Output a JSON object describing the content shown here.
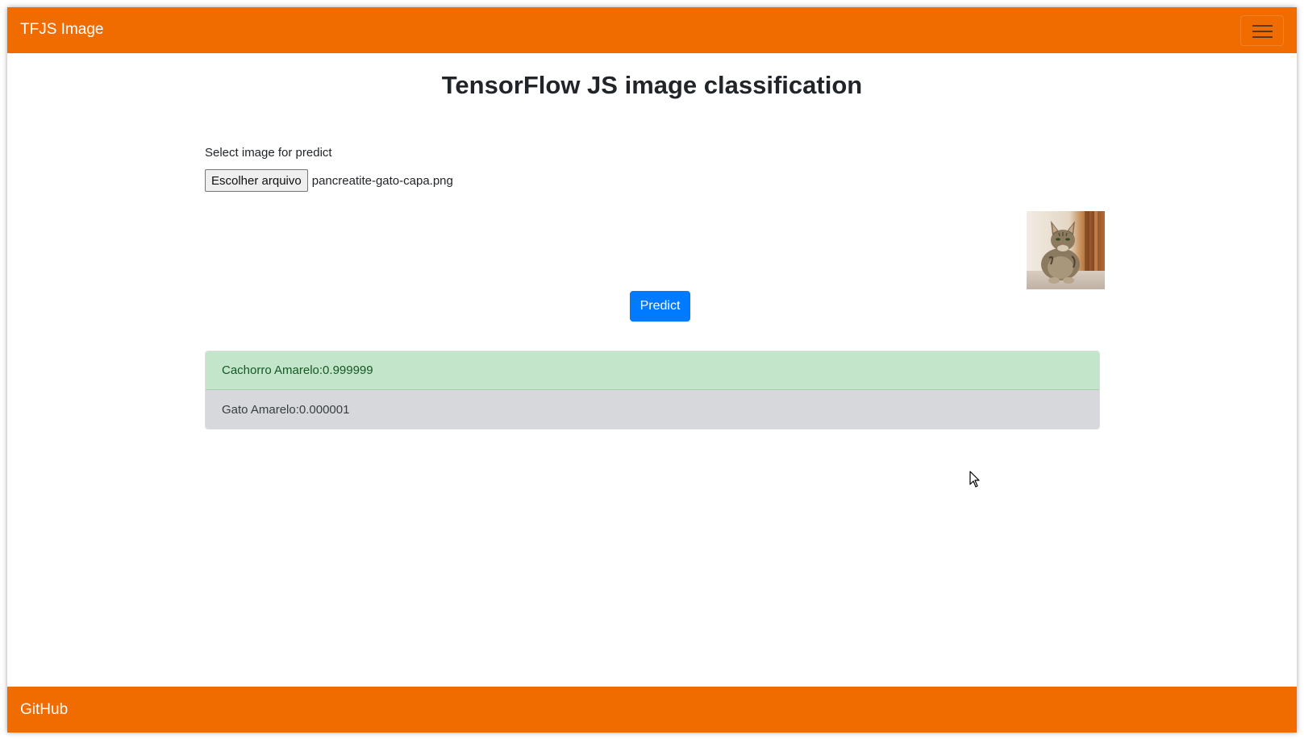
{
  "navbar": {
    "brand": "TFJS Image",
    "bg_color": "#f06b00",
    "toggler_icon": "hamburger-menu-icon"
  },
  "page": {
    "title": "TensorFlow JS image classification"
  },
  "upload": {
    "label": "Select image for predict",
    "button_label": "Escolher arquivo",
    "file_name": "pancreatite-gato-capa.png"
  },
  "preview": {
    "alt": "cat-photo-preview"
  },
  "predict": {
    "button_label": "Predict",
    "color": "#007bff"
  },
  "results": [
    {
      "text": "Cachorro Amarelo:0.999999",
      "status": "success",
      "color": "#c3e6cb"
    },
    {
      "text": "Gato Amarelo:0.000001",
      "status": "secondary",
      "color": "#d6d8db"
    }
  ],
  "footer": {
    "link": "GitHub"
  }
}
